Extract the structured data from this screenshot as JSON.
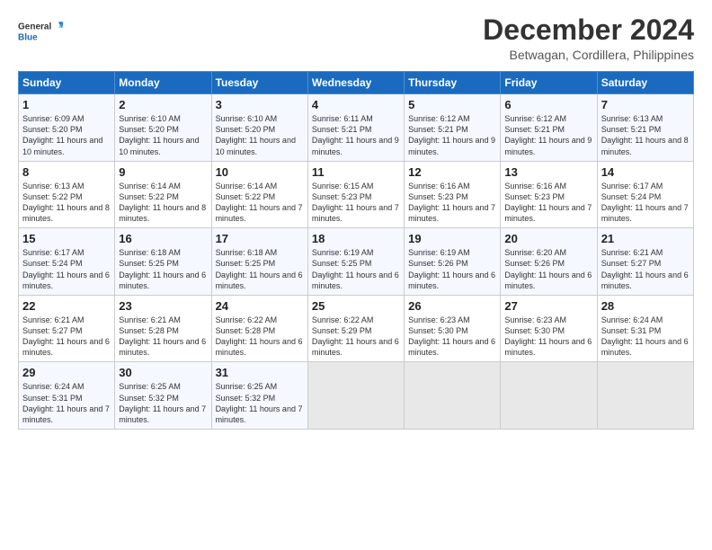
{
  "logo": {
    "general": "General",
    "blue": "Blue"
  },
  "title": "December 2024",
  "location": "Betwagan, Cordillera, Philippines",
  "days_header": [
    "Sunday",
    "Monday",
    "Tuesday",
    "Wednesday",
    "Thursday",
    "Friday",
    "Saturday"
  ],
  "weeks": [
    [
      {
        "day": "1",
        "sunrise": "6:09 AM",
        "sunset": "5:20 PM",
        "daylight": "11 hours and 10 minutes."
      },
      {
        "day": "2",
        "sunrise": "6:10 AM",
        "sunset": "5:20 PM",
        "daylight": "11 hours and 10 minutes."
      },
      {
        "day": "3",
        "sunrise": "6:10 AM",
        "sunset": "5:20 PM",
        "daylight": "11 hours and 10 minutes."
      },
      {
        "day": "4",
        "sunrise": "6:11 AM",
        "sunset": "5:21 PM",
        "daylight": "11 hours and 9 minutes."
      },
      {
        "day": "5",
        "sunrise": "6:12 AM",
        "sunset": "5:21 PM",
        "daylight": "11 hours and 9 minutes."
      },
      {
        "day": "6",
        "sunrise": "6:12 AM",
        "sunset": "5:21 PM",
        "daylight": "11 hours and 9 minutes."
      },
      {
        "day": "7",
        "sunrise": "6:13 AM",
        "sunset": "5:21 PM",
        "daylight": "11 hours and 8 minutes."
      }
    ],
    [
      {
        "day": "8",
        "sunrise": "6:13 AM",
        "sunset": "5:22 PM",
        "daylight": "11 hours and 8 minutes."
      },
      {
        "day": "9",
        "sunrise": "6:14 AM",
        "sunset": "5:22 PM",
        "daylight": "11 hours and 8 minutes."
      },
      {
        "day": "10",
        "sunrise": "6:14 AM",
        "sunset": "5:22 PM",
        "daylight": "11 hours and 7 minutes."
      },
      {
        "day": "11",
        "sunrise": "6:15 AM",
        "sunset": "5:23 PM",
        "daylight": "11 hours and 7 minutes."
      },
      {
        "day": "12",
        "sunrise": "6:16 AM",
        "sunset": "5:23 PM",
        "daylight": "11 hours and 7 minutes."
      },
      {
        "day": "13",
        "sunrise": "6:16 AM",
        "sunset": "5:23 PM",
        "daylight": "11 hours and 7 minutes."
      },
      {
        "day": "14",
        "sunrise": "6:17 AM",
        "sunset": "5:24 PM",
        "daylight": "11 hours and 7 minutes."
      }
    ],
    [
      {
        "day": "15",
        "sunrise": "6:17 AM",
        "sunset": "5:24 PM",
        "daylight": "11 hours and 6 minutes."
      },
      {
        "day": "16",
        "sunrise": "6:18 AM",
        "sunset": "5:25 PM",
        "daylight": "11 hours and 6 minutes."
      },
      {
        "day": "17",
        "sunrise": "6:18 AM",
        "sunset": "5:25 PM",
        "daylight": "11 hours and 6 minutes."
      },
      {
        "day": "18",
        "sunrise": "6:19 AM",
        "sunset": "5:25 PM",
        "daylight": "11 hours and 6 minutes."
      },
      {
        "day": "19",
        "sunrise": "6:19 AM",
        "sunset": "5:26 PM",
        "daylight": "11 hours and 6 minutes."
      },
      {
        "day": "20",
        "sunrise": "6:20 AM",
        "sunset": "5:26 PM",
        "daylight": "11 hours and 6 minutes."
      },
      {
        "day": "21",
        "sunrise": "6:21 AM",
        "sunset": "5:27 PM",
        "daylight": "11 hours and 6 minutes."
      }
    ],
    [
      {
        "day": "22",
        "sunrise": "6:21 AM",
        "sunset": "5:27 PM",
        "daylight": "11 hours and 6 minutes."
      },
      {
        "day": "23",
        "sunrise": "6:21 AM",
        "sunset": "5:28 PM",
        "daylight": "11 hours and 6 minutes."
      },
      {
        "day": "24",
        "sunrise": "6:22 AM",
        "sunset": "5:28 PM",
        "daylight": "11 hours and 6 minutes."
      },
      {
        "day": "25",
        "sunrise": "6:22 AM",
        "sunset": "5:29 PM",
        "daylight": "11 hours and 6 minutes."
      },
      {
        "day": "26",
        "sunrise": "6:23 AM",
        "sunset": "5:30 PM",
        "daylight": "11 hours and 6 minutes."
      },
      {
        "day": "27",
        "sunrise": "6:23 AM",
        "sunset": "5:30 PM",
        "daylight": "11 hours and 6 minutes."
      },
      {
        "day": "28",
        "sunrise": "6:24 AM",
        "sunset": "5:31 PM",
        "daylight": "11 hours and 6 minutes."
      }
    ],
    [
      {
        "day": "29",
        "sunrise": "6:24 AM",
        "sunset": "5:31 PM",
        "daylight": "11 hours and 7 minutes."
      },
      {
        "day": "30",
        "sunrise": "6:25 AM",
        "sunset": "5:32 PM",
        "daylight": "11 hours and 7 minutes."
      },
      {
        "day": "31",
        "sunrise": "6:25 AM",
        "sunset": "5:32 PM",
        "daylight": "11 hours and 7 minutes."
      },
      null,
      null,
      null,
      null
    ]
  ],
  "labels": {
    "sunrise": "Sunrise: ",
    "sunset": "Sunset: ",
    "daylight": "Daylight: "
  }
}
